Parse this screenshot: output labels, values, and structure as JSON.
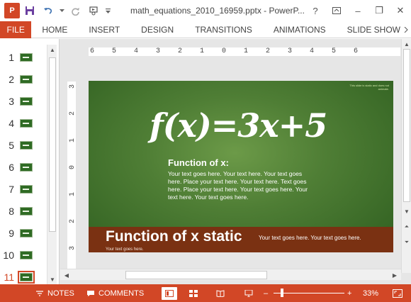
{
  "window": {
    "title": "math_equations_2010_16959.pptx - PowerP...",
    "controls": {
      "help": "?",
      "minimize": "–",
      "restore": "❐",
      "close": "✕"
    }
  },
  "qat": {
    "app_logo": "P"
  },
  "ribbon": {
    "file_tab": "FILE",
    "tabs": [
      "HOME",
      "INSERT",
      "DESIGN",
      "TRANSITIONS",
      "ANIMATIONS",
      "SLIDE SHOW"
    ]
  },
  "thumbnails": {
    "numbers": [
      "1",
      "2",
      "3",
      "4",
      "5",
      "6",
      "7",
      "8",
      "9",
      "10",
      "11"
    ],
    "selected": "11"
  },
  "ruler": {
    "horizontal": [
      "6",
      "5",
      "4",
      "3",
      "2",
      "1",
      "0",
      "1",
      "2",
      "3",
      "4",
      "5",
      "6"
    ],
    "vertical": [
      "3",
      "2",
      "1",
      "0",
      "1",
      "2",
      "3"
    ]
  },
  "slide": {
    "corner_note": "This slide is static and does not animate.",
    "equation": "f(x)=3x+5",
    "subheading": "Function of x:",
    "body": "Your text goes here. Your text here. Your text goes here. Place your text here. Your text here. Text goes here. Place your text here. Your text goes here. Your text here. Your text goes here.",
    "band_title": "Function of x static",
    "band_text": "Your text goes here. Your text goes here.",
    "band_small": "Your text goes here."
  },
  "statusbar": {
    "notes": "NOTES",
    "comments": "COMMENTS",
    "zoom_level": "33%",
    "zoom_minus": "–",
    "zoom_plus": "+"
  },
  "colors": {
    "accent": "#d24726",
    "slide_green": "#4f7e35",
    "band_brown": "#7a3112"
  }
}
